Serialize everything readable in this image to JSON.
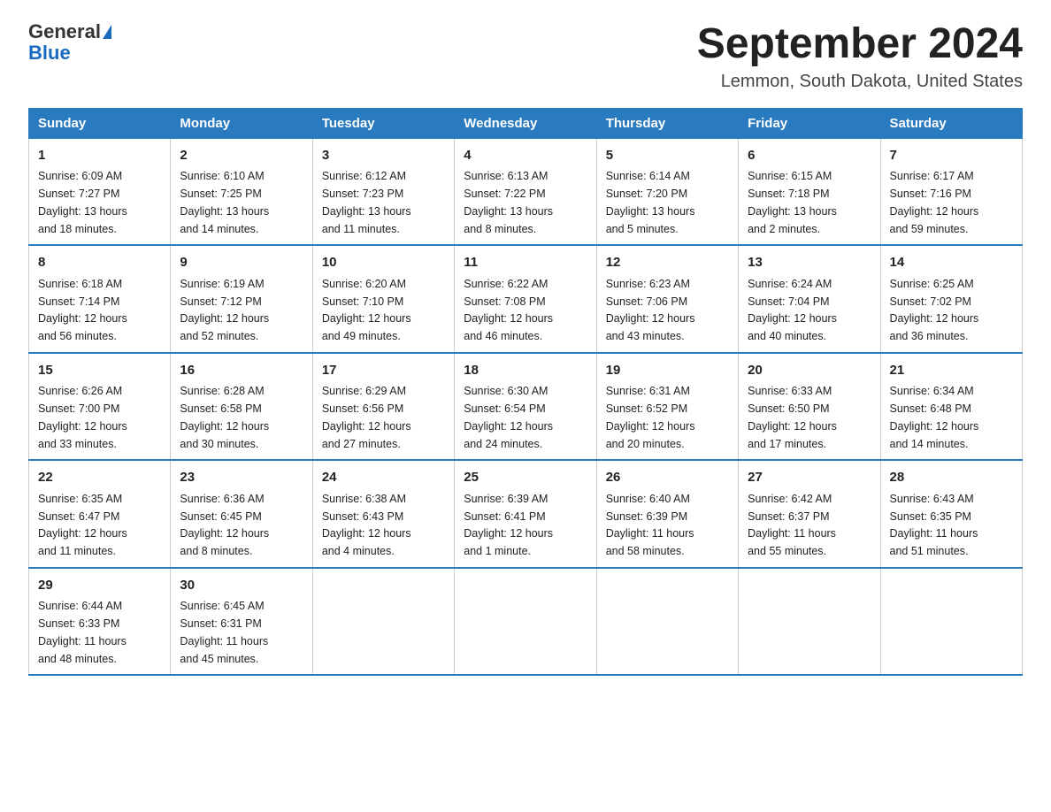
{
  "header": {
    "logo_line1": "General",
    "logo_line2": "Blue",
    "month_title": "September 2024",
    "location": "Lemmon, South Dakota, United States"
  },
  "days_of_week": [
    "Sunday",
    "Monday",
    "Tuesday",
    "Wednesday",
    "Thursday",
    "Friday",
    "Saturday"
  ],
  "weeks": [
    [
      {
        "day": "1",
        "info": "Sunrise: 6:09 AM\nSunset: 7:27 PM\nDaylight: 13 hours\nand 18 minutes."
      },
      {
        "day": "2",
        "info": "Sunrise: 6:10 AM\nSunset: 7:25 PM\nDaylight: 13 hours\nand 14 minutes."
      },
      {
        "day": "3",
        "info": "Sunrise: 6:12 AM\nSunset: 7:23 PM\nDaylight: 13 hours\nand 11 minutes."
      },
      {
        "day": "4",
        "info": "Sunrise: 6:13 AM\nSunset: 7:22 PM\nDaylight: 13 hours\nand 8 minutes."
      },
      {
        "day": "5",
        "info": "Sunrise: 6:14 AM\nSunset: 7:20 PM\nDaylight: 13 hours\nand 5 minutes."
      },
      {
        "day": "6",
        "info": "Sunrise: 6:15 AM\nSunset: 7:18 PM\nDaylight: 13 hours\nand 2 minutes."
      },
      {
        "day": "7",
        "info": "Sunrise: 6:17 AM\nSunset: 7:16 PM\nDaylight: 12 hours\nand 59 minutes."
      }
    ],
    [
      {
        "day": "8",
        "info": "Sunrise: 6:18 AM\nSunset: 7:14 PM\nDaylight: 12 hours\nand 56 minutes."
      },
      {
        "day": "9",
        "info": "Sunrise: 6:19 AM\nSunset: 7:12 PM\nDaylight: 12 hours\nand 52 minutes."
      },
      {
        "day": "10",
        "info": "Sunrise: 6:20 AM\nSunset: 7:10 PM\nDaylight: 12 hours\nand 49 minutes."
      },
      {
        "day": "11",
        "info": "Sunrise: 6:22 AM\nSunset: 7:08 PM\nDaylight: 12 hours\nand 46 minutes."
      },
      {
        "day": "12",
        "info": "Sunrise: 6:23 AM\nSunset: 7:06 PM\nDaylight: 12 hours\nand 43 minutes."
      },
      {
        "day": "13",
        "info": "Sunrise: 6:24 AM\nSunset: 7:04 PM\nDaylight: 12 hours\nand 40 minutes."
      },
      {
        "day": "14",
        "info": "Sunrise: 6:25 AM\nSunset: 7:02 PM\nDaylight: 12 hours\nand 36 minutes."
      }
    ],
    [
      {
        "day": "15",
        "info": "Sunrise: 6:26 AM\nSunset: 7:00 PM\nDaylight: 12 hours\nand 33 minutes."
      },
      {
        "day": "16",
        "info": "Sunrise: 6:28 AM\nSunset: 6:58 PM\nDaylight: 12 hours\nand 30 minutes."
      },
      {
        "day": "17",
        "info": "Sunrise: 6:29 AM\nSunset: 6:56 PM\nDaylight: 12 hours\nand 27 minutes."
      },
      {
        "day": "18",
        "info": "Sunrise: 6:30 AM\nSunset: 6:54 PM\nDaylight: 12 hours\nand 24 minutes."
      },
      {
        "day": "19",
        "info": "Sunrise: 6:31 AM\nSunset: 6:52 PM\nDaylight: 12 hours\nand 20 minutes."
      },
      {
        "day": "20",
        "info": "Sunrise: 6:33 AM\nSunset: 6:50 PM\nDaylight: 12 hours\nand 17 minutes."
      },
      {
        "day": "21",
        "info": "Sunrise: 6:34 AM\nSunset: 6:48 PM\nDaylight: 12 hours\nand 14 minutes."
      }
    ],
    [
      {
        "day": "22",
        "info": "Sunrise: 6:35 AM\nSunset: 6:47 PM\nDaylight: 12 hours\nand 11 minutes."
      },
      {
        "day": "23",
        "info": "Sunrise: 6:36 AM\nSunset: 6:45 PM\nDaylight: 12 hours\nand 8 minutes."
      },
      {
        "day": "24",
        "info": "Sunrise: 6:38 AM\nSunset: 6:43 PM\nDaylight: 12 hours\nand 4 minutes."
      },
      {
        "day": "25",
        "info": "Sunrise: 6:39 AM\nSunset: 6:41 PM\nDaylight: 12 hours\nand 1 minute."
      },
      {
        "day": "26",
        "info": "Sunrise: 6:40 AM\nSunset: 6:39 PM\nDaylight: 11 hours\nand 58 minutes."
      },
      {
        "day": "27",
        "info": "Sunrise: 6:42 AM\nSunset: 6:37 PM\nDaylight: 11 hours\nand 55 minutes."
      },
      {
        "day": "28",
        "info": "Sunrise: 6:43 AM\nSunset: 6:35 PM\nDaylight: 11 hours\nand 51 minutes."
      }
    ],
    [
      {
        "day": "29",
        "info": "Sunrise: 6:44 AM\nSunset: 6:33 PM\nDaylight: 11 hours\nand 48 minutes."
      },
      {
        "day": "30",
        "info": "Sunrise: 6:45 AM\nSunset: 6:31 PM\nDaylight: 11 hours\nand 45 minutes."
      },
      {
        "day": "",
        "info": ""
      },
      {
        "day": "",
        "info": ""
      },
      {
        "day": "",
        "info": ""
      },
      {
        "day": "",
        "info": ""
      },
      {
        "day": "",
        "info": ""
      }
    ]
  ]
}
